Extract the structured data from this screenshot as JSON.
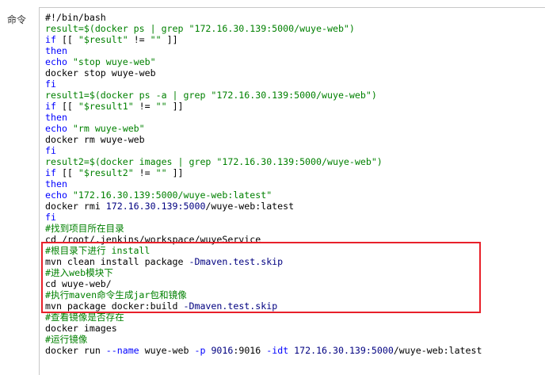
{
  "field_label": "命令",
  "code_lines": [
    {
      "segments": [
        {
          "t": "#!/bin/bash",
          "c": "tx"
        }
      ]
    },
    {
      "segments": [
        {
          "t": "result=$(docker ps | grep \"172.16.30.139:5000/wuye-web\")",
          "c": "st"
        }
      ]
    },
    {
      "segments": [
        {
          "t": "if",
          "c": "kw"
        },
        {
          "t": " [[ ",
          "c": "tx"
        },
        {
          "t": "\"$result\"",
          "c": "st"
        },
        {
          "t": " != ",
          "c": "tx"
        },
        {
          "t": "\"\"",
          "c": "st"
        },
        {
          "t": " ]]",
          "c": "tx"
        }
      ]
    },
    {
      "segments": [
        {
          "t": "then",
          "c": "kw"
        }
      ]
    },
    {
      "segments": [
        {
          "t": "echo",
          "c": "kw"
        },
        {
          "t": " ",
          "c": "tx"
        },
        {
          "t": "\"stop wuye-web\"",
          "c": "st"
        }
      ]
    },
    {
      "segments": [
        {
          "t": "docker stop wuye-web",
          "c": "tx"
        }
      ]
    },
    {
      "segments": [
        {
          "t": "fi",
          "c": "kw"
        }
      ]
    },
    {
      "segments": [
        {
          "t": "result1=$(docker ps -a | grep \"172.16.30.139:5000/wuye-web\")",
          "c": "st"
        }
      ]
    },
    {
      "segments": [
        {
          "t": "if",
          "c": "kw"
        },
        {
          "t": " [[ ",
          "c": "tx"
        },
        {
          "t": "\"$result1\"",
          "c": "st"
        },
        {
          "t": " != ",
          "c": "tx"
        },
        {
          "t": "\"\"",
          "c": "st"
        },
        {
          "t": " ]]",
          "c": "tx"
        }
      ]
    },
    {
      "segments": [
        {
          "t": "then",
          "c": "kw"
        }
      ]
    },
    {
      "segments": [
        {
          "t": "echo",
          "c": "kw"
        },
        {
          "t": " ",
          "c": "tx"
        },
        {
          "t": "\"rm wuye-web\"",
          "c": "st"
        }
      ]
    },
    {
      "segments": [
        {
          "t": "docker rm wuye-web",
          "c": "tx"
        }
      ]
    },
    {
      "segments": [
        {
          "t": "fi",
          "c": "kw"
        }
      ]
    },
    {
      "segments": [
        {
          "t": "result2=$(docker images | grep \"172.16.30.139:5000/wuye-web\")",
          "c": "st"
        }
      ]
    },
    {
      "segments": [
        {
          "t": "if",
          "c": "kw"
        },
        {
          "t": " [[ ",
          "c": "tx"
        },
        {
          "t": "\"$result2\"",
          "c": "st"
        },
        {
          "t": " != ",
          "c": "tx"
        },
        {
          "t": "\"\"",
          "c": "st"
        },
        {
          "t": " ]]",
          "c": "tx"
        }
      ]
    },
    {
      "segments": [
        {
          "t": "then",
          "c": "kw"
        }
      ]
    },
    {
      "segments": [
        {
          "t": "echo",
          "c": "kw"
        },
        {
          "t": " ",
          "c": "tx"
        },
        {
          "t": "\"172.16.30.139:5000/wuye-web:latest\"",
          "c": "st"
        }
      ]
    },
    {
      "segments": [
        {
          "t": "docker rmi ",
          "c": "tx"
        },
        {
          "t": "172.16.30.139:5000",
          "c": "nu"
        },
        {
          "t": "/wuye-web:latest",
          "c": "tx"
        }
      ]
    },
    {
      "segments": [
        {
          "t": "fi",
          "c": "kw"
        }
      ]
    },
    {
      "segments": [
        {
          "t": "#找到项目所在目录",
          "c": "cm"
        }
      ]
    },
    {
      "segments": [
        {
          "t": "cd /root/.jenkins/workspace/wuyeService",
          "c": "tx"
        }
      ]
    },
    {
      "segments": [
        {
          "t": "#根目录下进行 install",
          "c": "cm"
        }
      ]
    },
    {
      "segments": [
        {
          "t": "mvn clean install package ",
          "c": "tx"
        },
        {
          "t": "-Dmaven.test.skip",
          "c": "nu"
        }
      ]
    },
    {
      "segments": [
        {
          "t": "#进入web模块下",
          "c": "cm"
        }
      ]
    },
    {
      "segments": [
        {
          "t": "cd wuye-web/",
          "c": "tx"
        }
      ]
    },
    {
      "segments": [
        {
          "t": "#执行maven命令生成jar包和镜像",
          "c": "cm"
        }
      ]
    },
    {
      "segments": [
        {
          "t": "mvn package docker:build ",
          "c": "tx"
        },
        {
          "t": "-Dmaven.test.skip",
          "c": "nu"
        }
      ]
    },
    {
      "segments": [
        {
          "t": "#查看镜像是否存在",
          "c": "cm"
        }
      ]
    },
    {
      "segments": [
        {
          "t": "docker images",
          "c": "tx"
        }
      ]
    },
    {
      "segments": [
        {
          "t": "#运行镜像",
          "c": "cm"
        }
      ]
    },
    {
      "segments": [
        {
          "t": "docker run ",
          "c": "tx"
        },
        {
          "t": "--name",
          "c": "kw"
        },
        {
          "t": " wuye-web ",
          "c": "tx"
        },
        {
          "t": "-p",
          "c": "kw"
        },
        {
          "t": " ",
          "c": "tx"
        },
        {
          "t": "9016",
          "c": "nu"
        },
        {
          "t": ":9016 ",
          "c": "tx"
        },
        {
          "t": "-idt",
          "c": "kw"
        },
        {
          "t": " ",
          "c": "tx"
        },
        {
          "t": "172.16.30.139:5000",
          "c": "nu"
        },
        {
          "t": "/wuye-web:latest",
          "c": "tx"
        }
      ]
    }
  ],
  "colors": {
    "keyword": "#0000ff",
    "comment": "#008000",
    "string": "#008000",
    "number": "#000080",
    "highlight_border": "#e8202a"
  }
}
